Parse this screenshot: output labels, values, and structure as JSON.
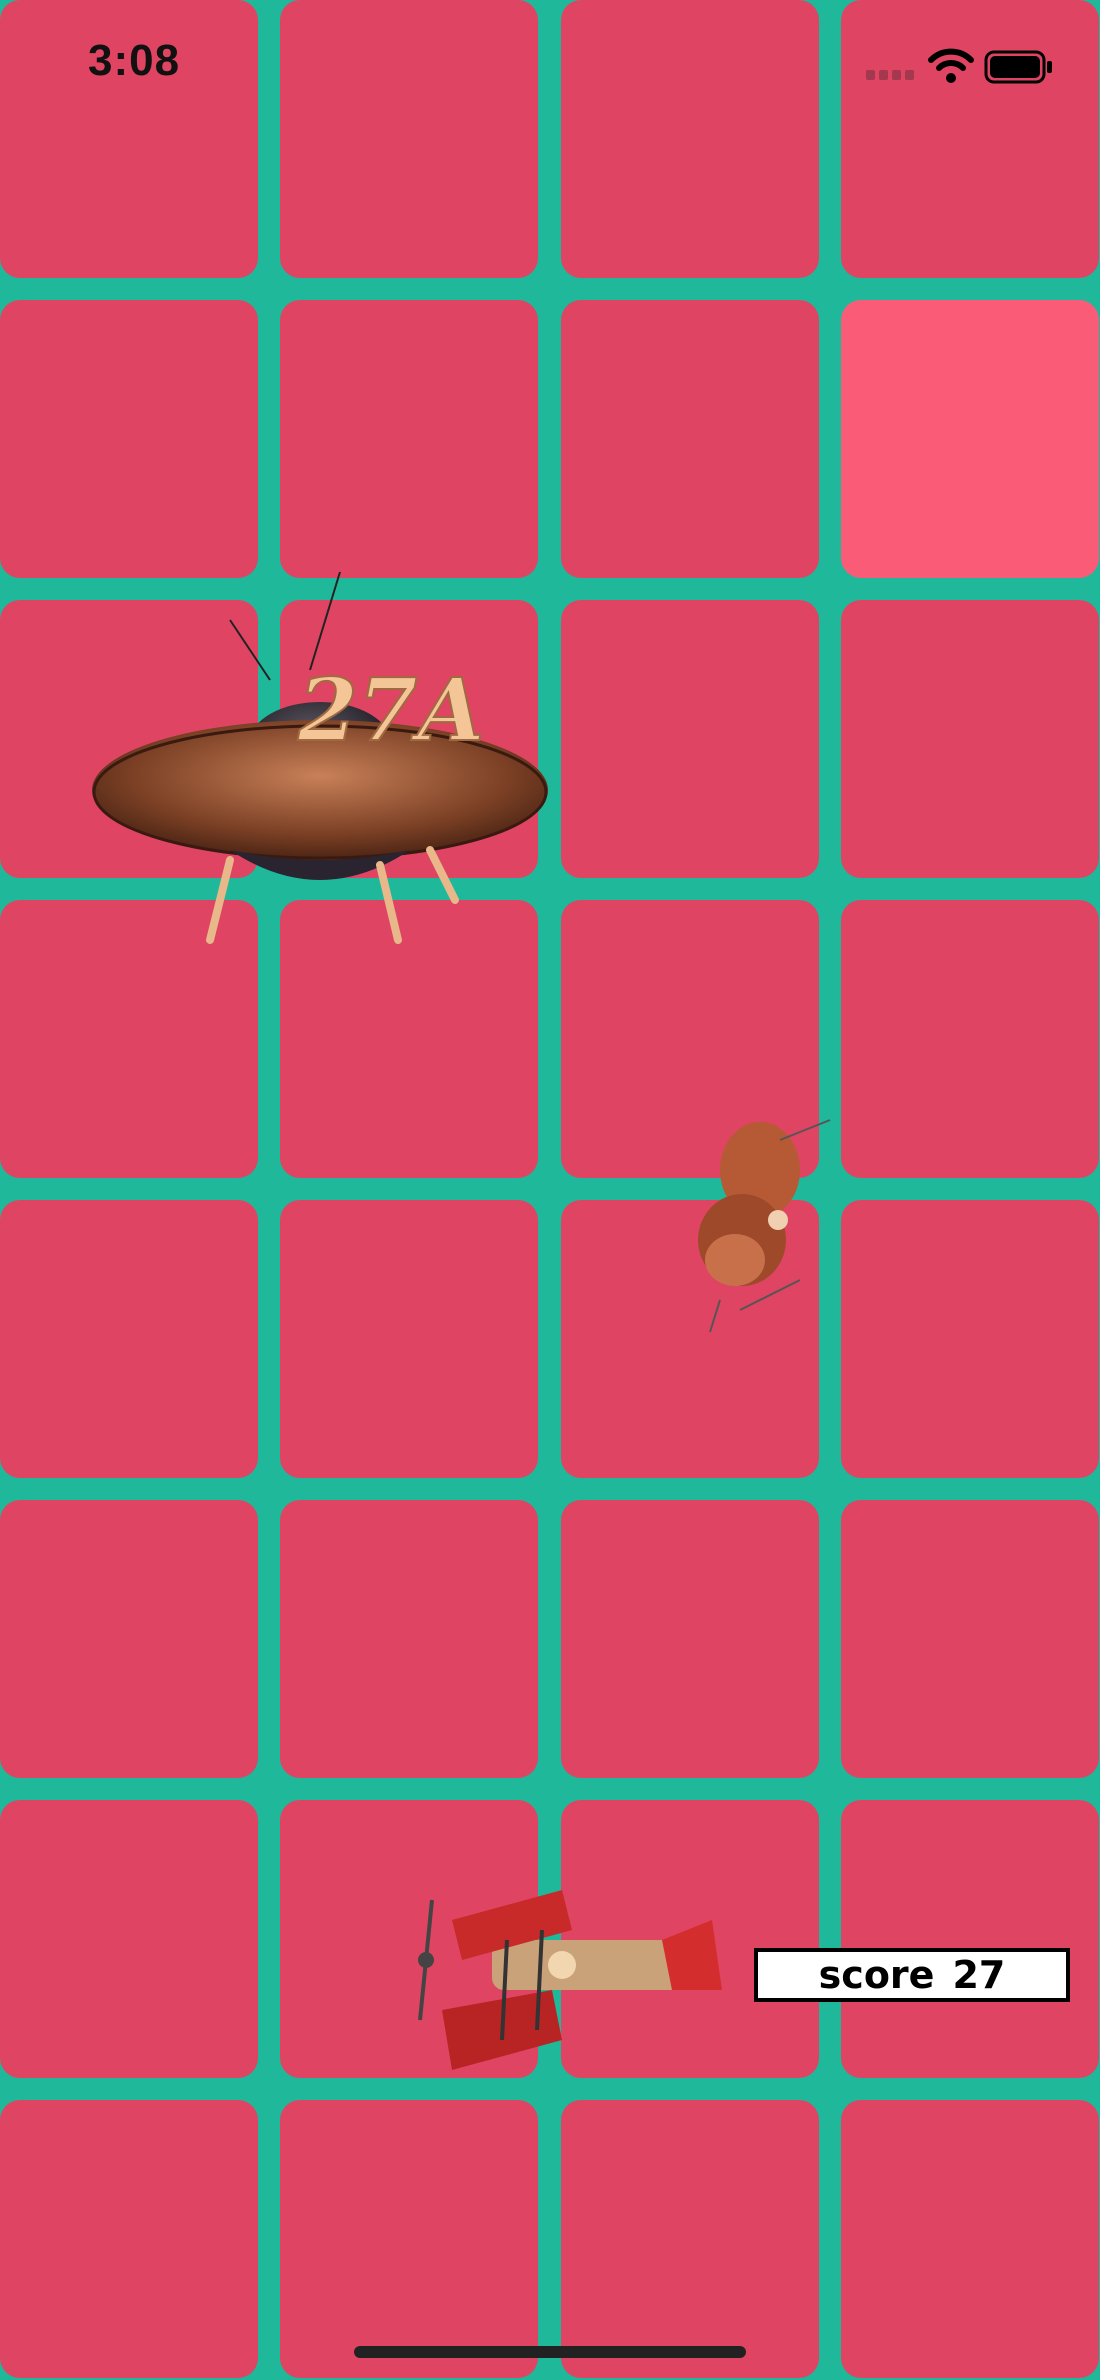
{
  "status_bar": {
    "time": "3:08",
    "signal_icon": "cellular-signal-icon",
    "wifi_icon": "wifi-icon",
    "battery_icon": "battery-icon"
  },
  "colors": {
    "background": "#1fb89a",
    "tile": "#e04463",
    "tile_highlight": "#fa5c78",
    "score_box_bg": "#ffffff",
    "score_box_border": "#000000"
  },
  "grid": {
    "columns": 4,
    "rows": 8,
    "highlighted_tile": {
      "row": 2,
      "col": 4
    }
  },
  "hud": {
    "score_label": "score",
    "score_value": "27"
  },
  "objects": {
    "ufo_label": "27A",
    "ufo_icon": "flying-saucer-icon",
    "plane_icon": "biplane-icon",
    "bug_icon": "small-propeller-craft-icon"
  }
}
